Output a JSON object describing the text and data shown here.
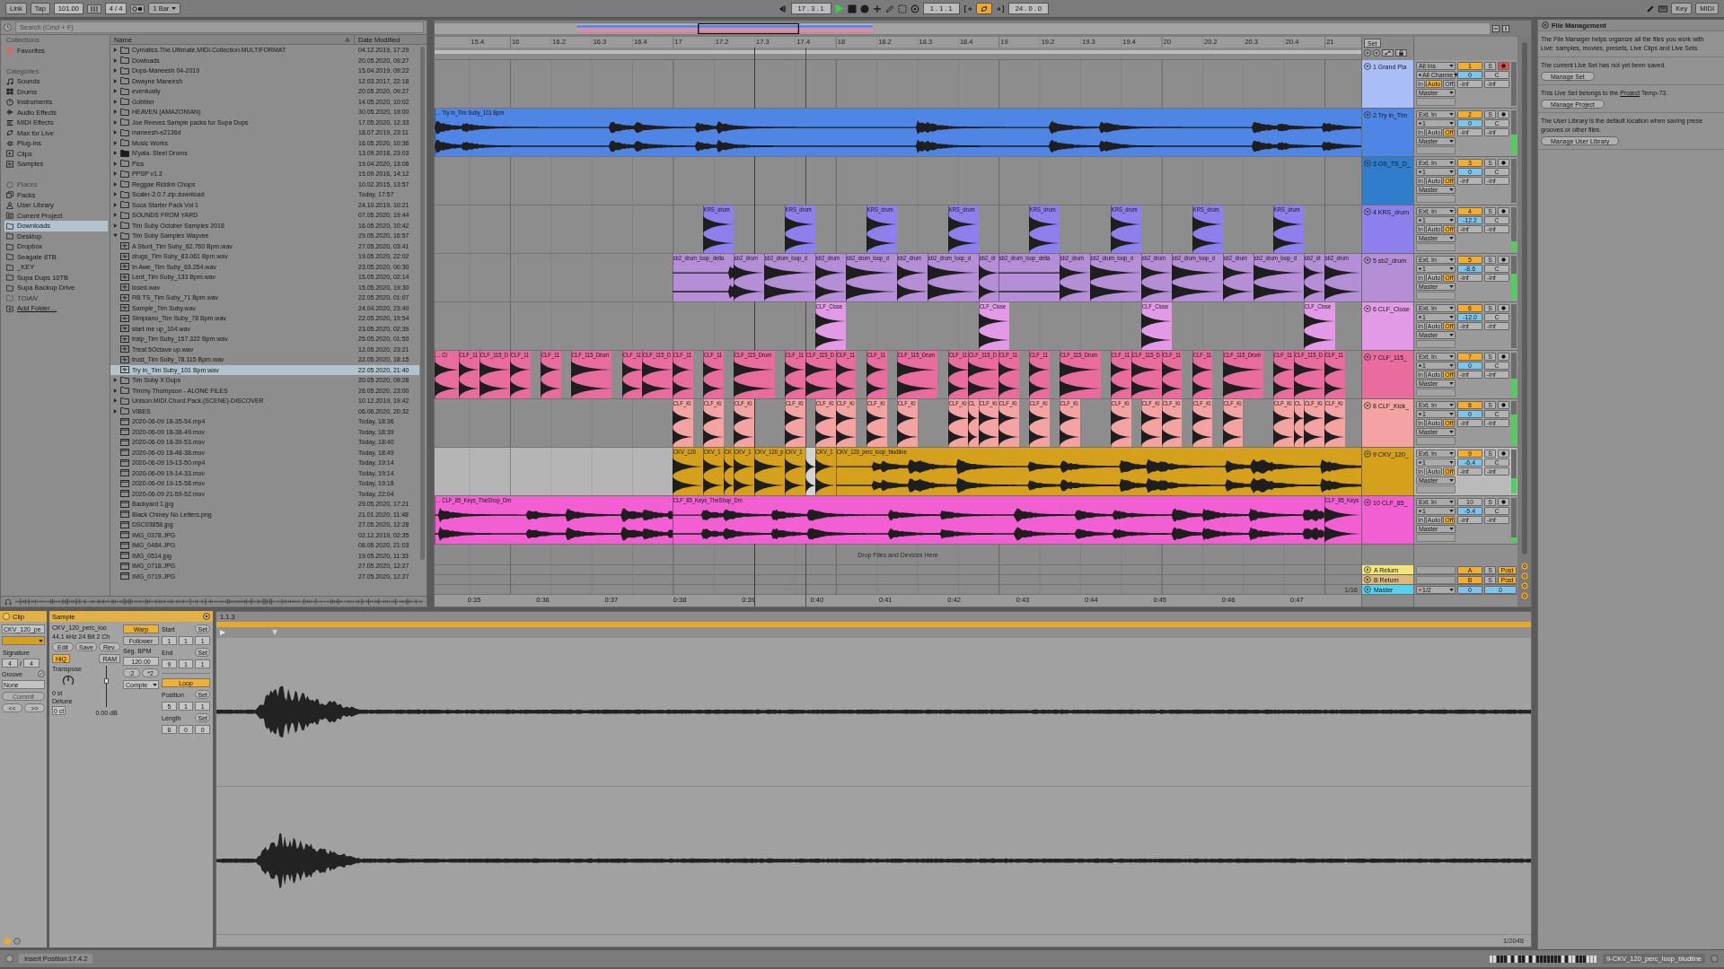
{
  "control_bar": {
    "link": "Link",
    "tap": "Tap",
    "tempo": "101.00",
    "time_signature": "4 / 4",
    "quantization": "1 Bar",
    "position": "17 . 3 . 1",
    "playing": true,
    "loop_start": "1 . 1 . 1",
    "loop_on": true,
    "loop_length": "24 . 0 . 0",
    "key": "Key",
    "midi": "MIDI"
  },
  "browser": {
    "search": {
      "placeholder": "Search (Cmd + F)"
    },
    "collections": {
      "heading": "Collections",
      "items": [
        {
          "label": "Favorites",
          "color": "#c9706e",
          "selected": false
        }
      ]
    },
    "categories": {
      "heading": "Categories",
      "items": [
        {
          "label": "Sounds",
          "selected": false
        },
        {
          "label": "Drums",
          "selected": false
        },
        {
          "label": "Instruments",
          "selected": false
        },
        {
          "label": "Audio Effects",
          "selected": false
        },
        {
          "label": "MIDI Effects",
          "selected": false
        },
        {
          "label": "Max for Live",
          "selected": false
        },
        {
          "label": "Plug-ins",
          "selected": false
        },
        {
          "label": "Clips",
          "selected": false
        },
        {
          "label": "Samples",
          "selected": false
        }
      ]
    },
    "places": {
      "heading": "Places",
      "items": [
        {
          "label": "Packs",
          "kind": "packs",
          "selected": false,
          "disabled": false
        },
        {
          "label": "User Library",
          "kind": "user",
          "selected": false,
          "disabled": false
        },
        {
          "label": "Current Project",
          "kind": "project",
          "selected": false,
          "disabled": false
        },
        {
          "label": "Downloads",
          "kind": "folder",
          "selected": true,
          "disabled": false
        },
        {
          "label": "Desktop",
          "kind": "folder",
          "selected": false,
          "disabled": false
        },
        {
          "label": "Dropbox",
          "kind": "folder",
          "selected": false,
          "disabled": false
        },
        {
          "label": "Seagate 8TB",
          "kind": "folder",
          "selected": false,
          "disabled": false
        },
        {
          "label": "_KEY",
          "kind": "folder",
          "selected": false,
          "disabled": false
        },
        {
          "label": "Supa Dups 10TB",
          "kind": "folder",
          "selected": false,
          "disabled": false
        },
        {
          "label": "Supa Backup Drive",
          "kind": "folder",
          "selected": false,
          "disabled": false
        },
        {
          "label": "TOIAN",
          "kind": "folder",
          "selected": false,
          "disabled": true
        }
      ],
      "add_folder": "Add Folder…"
    },
    "columns": {
      "name": "Name",
      "date": "Date Modified"
    },
    "files": [
      {
        "name": "Cymatics.The.Ultimate.MIDI.Collection.MULTIFORMAT",
        "date": "04.12.2019, 17:29",
        "kind": "folder",
        "expanded": false,
        "selected": false
      },
      {
        "name": "Dowloads",
        "date": "20.05.2020, 09:27",
        "kind": "folder",
        "expanded": false,
        "selected": false
      },
      {
        "name": "Dups-Maneesh 04-2019",
        "date": "15.04.2019, 09:22",
        "kind": "folder",
        "expanded": false,
        "selected": false
      },
      {
        "name": "Dwayne Maneesh",
        "date": "12.03.2017, 22:18",
        "kind": "folder",
        "expanded": false,
        "selected": false
      },
      {
        "name": "eventually",
        "date": "20.05.2020, 09:27",
        "kind": "folder",
        "expanded": false,
        "selected": false
      },
      {
        "name": "Gobbler",
        "date": "14.05.2020, 10:02",
        "kind": "folder",
        "expanded": false,
        "selected": false
      },
      {
        "name": "HEAVEN (AMAZONIAN)",
        "date": "30.05.2020, 19:00",
        "kind": "folder",
        "expanded": false,
        "selected": false
      },
      {
        "name": "Joe Reeves Sample packs for Supa Dups",
        "date": "17.05.2020, 12:33",
        "kind": "folder",
        "expanded": false,
        "selected": false
      },
      {
        "name": "maneesh-e2136d",
        "date": "18.07.2019, 23:11",
        "kind": "folder",
        "expanded": false,
        "selected": false
      },
      {
        "name": "Music Works",
        "date": "16.05.2020, 10:36",
        "kind": "folder",
        "expanded": false,
        "selected": false
      },
      {
        "name": "N'yala. Steel Drums",
        "date": "13.09.2018, 23:03",
        "kind": "pack",
        "expanded": false,
        "selected": false
      },
      {
        "name": "Pics",
        "date": "19.04.2020, 13:06",
        "kind": "folder",
        "expanded": false,
        "selected": false
      },
      {
        "name": "PPSP v1.3",
        "date": "15.09.2016, 14:12",
        "kind": "folder",
        "expanded": false,
        "selected": false
      },
      {
        "name": "Reggae Riddim Chops",
        "date": "10.02.2015, 13:57",
        "kind": "folder",
        "expanded": false,
        "selected": false
      },
      {
        "name": "Scaler-2.0.7.zip.download",
        "date": "Today, 17:57",
        "kind": "folder",
        "expanded": false,
        "selected": false
      },
      {
        "name": "Soca Starter Pack Vol 1",
        "date": "24.10.2019, 10:21",
        "kind": "folder",
        "expanded": false,
        "selected": false
      },
      {
        "name": "SOUNDS FROM YARD",
        "date": "07.05.2020, 19:44",
        "kind": "folder",
        "expanded": false,
        "selected": false
      },
      {
        "name": "Tim Suby October Samples 2018",
        "date": "16.05.2020, 10:42",
        "kind": "folder",
        "expanded": false,
        "selected": false
      },
      {
        "name": "Tim Suby Samples Wayvee",
        "date": "29.05.2020, 16:57",
        "kind": "folder",
        "expanded": true,
        "selected": false,
        "children": [
          {
            "name": "A Stunt_Tim Suby_82.760 Bpm.wav",
            "date": "27.05.2020, 03:41",
            "kind": "audio",
            "selected": false
          },
          {
            "name": "drugs_Tim Suby_83.061 Bpm.wav",
            "date": "19.05.2020, 22:02",
            "kind": "audio",
            "selected": false
          },
          {
            "name": "In Awe_Tim Suby_63.254.wav",
            "date": "23.05.2020, 00:30",
            "kind": "audio",
            "selected": false
          },
          {
            "name": "Lent_Tim Suby_133 Bpm.wav",
            "date": "15.05.2020, 02:14",
            "kind": "audio",
            "selected": false
          },
          {
            "name": "losed.wav",
            "date": "15.05.2020, 19:30",
            "kind": "audio",
            "selected": false
          },
          {
            "name": "RB TS_Tim Suby_71 Bpm.wav",
            "date": "22.05.2020, 01:07",
            "kind": "audio",
            "selected": false
          },
          {
            "name": "Sample_Tim Suby.wav",
            "date": "24.04.2020, 23:40",
            "kind": "audio",
            "selected": false
          },
          {
            "name": "Simpiano_Tim Suby_78 Bpm.wav",
            "date": "22.05.2020, 19:54",
            "kind": "audio",
            "selected": false
          },
          {
            "name": "start me up_104.wav",
            "date": "23.05.2020, 02:39",
            "kind": "audio",
            "selected": false
          },
          {
            "name": "traip_Tim Suby_157.322 Bpm.wav",
            "date": "25.05.2020, 01:50",
            "kind": "audio",
            "selected": false
          },
          {
            "name": "Treat 5Octave up.wav",
            "date": "12.05.2020, 23:21",
            "kind": "audio",
            "selected": false
          },
          {
            "name": "trust_Tim Suby_78.115 Bpm.wav",
            "date": "22.05.2020, 18:15",
            "kind": "audio",
            "selected": false
          },
          {
            "name": "Try in_Tim Suby_101 Bpm.wav",
            "date": "22.05.2020, 21:40",
            "kind": "audio",
            "selected": true
          }
        ]
      },
      {
        "name": "Tim Suby X Dups",
        "date": "20.05.2020, 09:28",
        "kind": "folder",
        "expanded": false,
        "selected": false
      },
      {
        "name": "Timmy Thompson - ALONE FILES",
        "date": "26.05.2020, 23:00",
        "kind": "folder",
        "expanded": false,
        "selected": false
      },
      {
        "name": "Unison.MIDI.Chord.Pack.(SCENE)-DISCOVER",
        "date": "10.12.2019, 19:42",
        "kind": "folder",
        "expanded": false,
        "selected": false
      },
      {
        "name": "VIBES",
        "date": "06.06.2020, 20:32",
        "kind": "folder",
        "expanded": false,
        "selected": false
      },
      {
        "name": "2020-06-09 18-35-54.mp4",
        "date": "Today, 18:36",
        "kind": "file",
        "selected": false
      },
      {
        "name": "2020-06-09 18-38-49.mov",
        "date": "Today, 18:39",
        "kind": "file",
        "selected": false
      },
      {
        "name": "2020-06-09 18-39-53.mov",
        "date": "Today, 18:40",
        "kind": "file",
        "selected": false
      },
      {
        "name": "2020-06-09 18-48-38.mov",
        "date": "Today, 18:49",
        "kind": "file",
        "selected": false
      },
      {
        "name": "2020-06-09 19-13-50.mp4",
        "date": "Today, 19:14",
        "kind": "file",
        "selected": false
      },
      {
        "name": "2020-06-09 19-14-33.mov",
        "date": "Today, 19:14",
        "kind": "file",
        "selected": false
      },
      {
        "name": "2020-06-09 19-15-58.mov",
        "date": "Today, 19:18",
        "kind": "file",
        "selected": false
      },
      {
        "name": "2020-06-09 21-59-52.mov",
        "date": "Today, 22:04",
        "kind": "file",
        "selected": false
      },
      {
        "name": "Backyard 1.jpg",
        "date": "29.05.2020, 17:21",
        "kind": "file",
        "selected": false
      },
      {
        "name": "Black Chiney No Letters.png",
        "date": "21.01.2020, 11:48",
        "kind": "file",
        "selected": false
      },
      {
        "name": "DSC03858.jpg",
        "date": "27.05.2020, 12:28",
        "kind": "file",
        "selected": false
      },
      {
        "name": "IMG_0378.JPG",
        "date": "02.12.2019, 02:35",
        "kind": "file",
        "selected": false
      },
      {
        "name": "IMG_0484.JPG",
        "date": "08.05.2020, 21:03",
        "kind": "file",
        "selected": false
      },
      {
        "name": "IMG_0514.jpg",
        "date": "19.05.2020, 11:33",
        "kind": "file",
        "selected": false
      },
      {
        "name": "IMG_0718.JPG",
        "date": "27.05.2020, 12:27",
        "kind": "file",
        "selected": false
      },
      {
        "name": "IMG_0719.JPG",
        "date": "27.05.2020, 12:27",
        "kind": "file",
        "selected": false
      }
    ]
  },
  "arrangement": {
    "ruler": [
      "15.4",
      "16",
      "16.2",
      "16.3",
      "16.4",
      "17",
      "17.2",
      "17.3",
      "17.4",
      "18",
      "18.2",
      "18.3",
      "18.4",
      "19",
      "19.2",
      "19.3",
      "19.4",
      "20",
      "20.2",
      "20.3",
      "20.4",
      "21"
    ],
    "set_button": "Set",
    "drop_hint": "Drop Files and Devices Here",
    "grid": "1/16",
    "time_ruler": [
      "0:35",
      "0:36",
      "0:37",
      "0:38",
      "0:39",
      "0:40",
      "0:41",
      "0:42",
      "0:43",
      "0:44",
      "0:45",
      "0:46",
      "0:47"
    ],
    "tracks": [
      {
        "number": "1",
        "name": "1 Grand Pia",
        "color": "#a9bef6",
        "selected": false,
        "active": true,
        "armed": true,
        "input": "All Ins",
        "channel": "All Channe",
        "monitor": [
          {
            "label": "In",
            "selected": false
          },
          {
            "label": "Auto",
            "selected": true
          },
          {
            "label": "Off",
            "selected": false
          }
        ],
        "output": "Master",
        "volume": "0",
        "pan": "C",
        "solo": "S",
        "peaks": [
          "-inf",
          "-inf"
        ],
        "meter": {
          "level": 0
        }
      },
      {
        "number": "2",
        "name": "2 Try in_Tim",
        "color": "#4f86e6",
        "selected": false,
        "active": true,
        "armed": false,
        "input": "Ext. In",
        "channel": "1",
        "monitor": [
          {
            "label": "In",
            "selected": false
          },
          {
            "label": "Auto",
            "selected": false
          },
          {
            "label": "Off",
            "selected": true
          }
        ],
        "output": "Master",
        "volume": "0",
        "pan": "C",
        "solo": "S",
        "peaks": [
          "-inf",
          "-inf"
        ],
        "meter": {
          "level": 0.45
        },
        "clips": [
          {
            "name": "… Try in_Tim Suby_101 Bpm",
            "selected": false
          }
        ]
      },
      {
        "number": "3",
        "name": "3 OS_TS_D_",
        "color": "#2f7dcb",
        "selected": false,
        "active": true,
        "armed": false,
        "input": "Ext. In",
        "channel": "1",
        "monitor": [
          {
            "label": "In",
            "selected": false
          },
          {
            "label": "Auto",
            "selected": false
          },
          {
            "label": "Off",
            "selected": true
          }
        ],
        "output": "Master",
        "volume": "0",
        "pan": "C",
        "solo": "S",
        "peaks": [
          "-inf",
          "-inf"
        ],
        "meter": {
          "level": 0
        }
      },
      {
        "number": "4",
        "name": "4 KRS_drum",
        "color": "#8e80ec",
        "selected": false,
        "active": true,
        "armed": false,
        "input": "Ext. In",
        "channel": "1",
        "monitor": [
          {
            "label": "In",
            "selected": false
          },
          {
            "label": "Auto",
            "selected": false
          },
          {
            "label": "Off",
            "selected": true
          }
        ],
        "output": "Master",
        "volume": "-12.2",
        "pan": "C",
        "solo": "S",
        "peaks": [
          "-inf",
          "-inf"
        ],
        "meter": {
          "level": 0.22
        },
        "clips": [
          {
            "name": "KRS_drum",
            "selected": false
          },
          {
            "name": "KRS_drum",
            "selected": false
          },
          {
            "name": "KRS_drum",
            "selected": false
          },
          {
            "name": "KRS_drum",
            "selected": false
          },
          {
            "name": "KRS_drum",
            "selected": false
          },
          {
            "name": "KRS_drum",
            "selected": false
          },
          {
            "name": "KRS_drum",
            "selected": false
          },
          {
            "name": "KRS_drum",
            "selected": false
          }
        ]
      },
      {
        "number": "5",
        "name": "5 sb2_drum",
        "color": "#b48fd6",
        "selected": false,
        "active": true,
        "armed": false,
        "input": "Ext. In",
        "channel": "1",
        "monitor": [
          {
            "label": "In",
            "selected": false
          },
          {
            "label": "Auto",
            "selected": false
          },
          {
            "label": "Off",
            "selected": true
          }
        ],
        "output": "Master",
        "volume": "-8.6",
        "pan": "C",
        "solo": "S",
        "peaks": [
          "-inf",
          "-inf"
        ],
        "meter": {
          "level": 0.6
        },
        "clips": [
          {
            "name": "sb2_drum_loop_delta",
            "selected": false
          },
          {
            "name": "sb2_drum",
            "selected": false
          },
          {
            "name": "sb2_drum_loop_d",
            "selected": false
          },
          {
            "name": "sb2_drum",
            "selected": false
          },
          {
            "name": "sb2_drum_loop_d",
            "selected": false
          },
          {
            "name": "sb2_drum",
            "selected": false
          },
          {
            "name": "sb2_drum_loop_d",
            "selected": false
          },
          {
            "name": "sb2_dr",
            "selected": false
          },
          {
            "name": "sb2_drum_loop_delta",
            "selected": false
          },
          {
            "name": "sb2_drum",
            "selected": false
          },
          {
            "name": "sb2_drum_loop_d",
            "selected": false
          },
          {
            "name": "sb2_drum",
            "selected": false
          },
          {
            "name": "sb2_drum_loop_d",
            "selected": false
          },
          {
            "name": "sb2_drum",
            "selected": false
          },
          {
            "name": "sb2_drum_loop_d",
            "selected": false
          },
          {
            "name": "sb2_dr",
            "selected": false
          },
          {
            "name": "sb2_drum",
            "selected": false
          }
        ]
      },
      {
        "number": "6",
        "name": "6 CLF_Close",
        "color": "#e39ae6",
        "selected": false,
        "active": true,
        "armed": false,
        "input": "Ext. In",
        "channel": "1",
        "monitor": [
          {
            "label": "In",
            "selected": false
          },
          {
            "label": "Auto",
            "selected": false
          },
          {
            "label": "Off",
            "selected": true
          }
        ],
        "output": "Master",
        "volume": "-12.0",
        "pan": "C",
        "solo": "S",
        "peaks": [
          "-inf",
          "-inf"
        ],
        "meter": {
          "level": 0
        },
        "clips": [
          {
            "name": "CLF_Close",
            "selected": false
          },
          {
            "name": "CLF_Close",
            "selected": false
          },
          {
            "name": "CLF_Close",
            "selected": false
          },
          {
            "name": "CLF_Close",
            "selected": false
          }
        ]
      },
      {
        "number": "7",
        "name": "7 CLF_115_",
        "color": "#e86c9e",
        "selected": false,
        "active": true,
        "armed": false,
        "input": "Ext. In",
        "channel": "1",
        "monitor": [
          {
            "label": "In",
            "selected": false
          },
          {
            "label": "Auto",
            "selected": false
          },
          {
            "label": "Off",
            "selected": true
          }
        ],
        "output": "Master",
        "volume": "0",
        "pan": "C",
        "solo": "S",
        "peaks": [
          "-inf",
          "-inf"
        ],
        "meter": {
          "level": 0.4
        },
        "clips": [
          {
            "name": "… Cl",
            "selected": false
          },
          {
            "name": "CLF_11",
            "selected": false
          },
          {
            "name": "CLF_115_D",
            "selected": false
          },
          {
            "name": "CLF_11",
            "selected": false
          },
          {
            "name": "CLF_11",
            "selected": false
          },
          {
            "name": "CLF_115_Drum",
            "selected": false
          },
          {
            "name": "CLF_11",
            "selected": false
          },
          {
            "name": "CLF_115_D",
            "selected": false
          },
          {
            "name": "CLF_11",
            "selected": false
          },
          {
            "name": "CLF_11",
            "selected": false
          },
          {
            "name": "CLF_115_Drum",
            "selected": false
          },
          {
            "name": "CLF_11",
            "selected": false
          },
          {
            "name": "CLF_115_D",
            "selected": false
          },
          {
            "name": "CLF_11",
            "selected": false
          },
          {
            "name": "CLF_11",
            "selected": false
          },
          {
            "name": "CLF_115_Drum",
            "selected": false
          },
          {
            "name": "CLF_11",
            "selected": false
          },
          {
            "name": "CLF_115_D",
            "selected": false
          },
          {
            "name": "CLF_11",
            "selected": false
          },
          {
            "name": "CLF_11",
            "selected": false
          },
          {
            "name": "CLF_115_Drum",
            "selected": false
          },
          {
            "name": "CLF_11",
            "selected": false
          },
          {
            "name": "CLF_115_D",
            "selected": false
          },
          {
            "name": "CLF_11",
            "selected": false
          },
          {
            "name": "CLF_11",
            "selected": false
          },
          {
            "name": "CLF_115_Drum",
            "selected": false
          },
          {
            "name": "CLF_11",
            "selected": false
          },
          {
            "name": "CLF_115_D",
            "selected": false
          },
          {
            "name": "CLF_11",
            "selected": false
          }
        ]
      },
      {
        "number": "8",
        "name": "8 CLF_Kick_",
        "color": "#f4a3a3",
        "selected": false,
        "active": true,
        "armed": false,
        "input": "Ext. In",
        "channel": "1",
        "monitor": [
          {
            "label": "In",
            "selected": false
          },
          {
            "label": "Auto",
            "selected": false
          },
          {
            "label": "Off",
            "selected": true
          }
        ],
        "output": "Master",
        "volume": "0",
        "pan": "C",
        "solo": "S",
        "peaks": [
          "-inf",
          "-inf"
        ],
        "meter": {
          "level": 0.7
        },
        "clips": [
          {
            "name": "CLF_Ki",
            "selected": false
          },
          {
            "name": "CLF_Ki",
            "selected": false
          },
          {
            "name": "CLF_Ki",
            "selected": false
          },
          {
            "name": "CLF_Ki",
            "selected": false
          },
          {
            "name": "CLF_Ki",
            "selected": false
          },
          {
            "name": "CLF_Ki",
            "selected": false
          },
          {
            "name": "CLF_Ki",
            "selected": false
          },
          {
            "name": "CLF_Ki",
            "selected": false
          },
          {
            "name": "CLF_Ki",
            "selected": false
          },
          {
            "name": "CL",
            "selected": false
          },
          {
            "name": "CLF_Ki",
            "selected": false
          },
          {
            "name": "CLF_Ki",
            "selected": false
          },
          {
            "name": "CLF_Ki",
            "selected": false
          },
          {
            "name": "CLF_Ki",
            "selected": false
          },
          {
            "name": "CLF_Ki",
            "selected": false
          },
          {
            "name": "CLF_Ki",
            "selected": false
          },
          {
            "name": "CLF_Ki",
            "selected": false
          },
          {
            "name": "CLF_Ki",
            "selected": false
          },
          {
            "name": "CLF_Ki",
            "selected": false
          },
          {
            "name": "CLF_Ki",
            "selected": false
          },
          {
            "name": "CL",
            "selected": false
          },
          {
            "name": "CLF_Ki",
            "selected": false
          },
          {
            "name": "CLF_Ki",
            "selected": false
          }
        ]
      },
      {
        "number": "9",
        "name": "9 CKV_120_",
        "color": "#d5a01b",
        "selected": true,
        "active": true,
        "armed": false,
        "input": "Ext. In",
        "channel": "1",
        "monitor": [
          {
            "label": "In",
            "selected": false
          },
          {
            "label": "Auto",
            "selected": false
          },
          {
            "label": "Off",
            "selected": true
          }
        ],
        "output": "Master",
        "volume": "-6.4",
        "pan": "C",
        "solo": "S",
        "peaks": [
          "-inf",
          "-inf"
        ],
        "meter": {
          "level": 0.35
        },
        "clips": [
          {
            "name": "CKV_120",
            "selected": false
          },
          {
            "name": "CKV_1",
            "selected": false
          },
          {
            "name": "CK",
            "selected": false
          },
          {
            "name": "CKV_1",
            "selected": false
          },
          {
            "name": "CKV_120_p",
            "selected": false
          },
          {
            "name": "CKV_1",
            "selected": false
          },
          {
            "selected": true
          },
          {
            "name": "CKV_1",
            "selected": false
          },
          {
            "name": "CKV_120_perc_loop_bludline",
            "selected": false
          }
        ]
      },
      {
        "number": "10",
        "name": "10 CLF_85_",
        "color": "#f25fd3",
        "selected": false,
        "active": false,
        "armed": false,
        "input": "Ext. In",
        "channel": "1",
        "monitor": [
          {
            "label": "In",
            "selected": false
          },
          {
            "label": "Auto",
            "selected": false
          },
          {
            "label": "Off",
            "selected": true
          }
        ],
        "output": "Master",
        "volume": "-5.4",
        "pan": "C",
        "solo": "S",
        "peaks": [
          "-inf",
          "-inf"
        ],
        "meter": {
          "level": 0.1
        },
        "clips": [
          {
            "name": "… CLF_85_Keys_TheShop_Dm",
            "selected": false
          },
          {
            "name": "CLF_85_Keys_TheShop_Dm",
            "selected": false
          },
          {
            "name": "CLF_85_Keys",
            "selected": false
          }
        ]
      }
    ],
    "returns": [
      {
        "number": "A",
        "name": "A Return",
        "color": "#f2e67a",
        "active": true,
        "solo": "S",
        "post": {
          "label": "Post",
          "on": true
        }
      },
      {
        "number": "B",
        "name": "B Return",
        "color": "#dcb87a",
        "active": true,
        "solo": "S",
        "post": {
          "label": "Post",
          "on": true
        }
      }
    ],
    "master": {
      "name": "Master",
      "color": "#58d2ec",
      "output": "1/2",
      "volume": "0",
      "pan": "0"
    }
  },
  "clip_view": {
    "clip": {
      "title": "Clip",
      "name": "CKV_120_pe",
      "signature_label": "Signature",
      "numerator": "4",
      "slash": "/",
      "denominator": "4",
      "groove_label": "Groove",
      "groove": "None",
      "commit": "Commit",
      "commit_disabled": true,
      "nudge_back": "<<",
      "nudge_forward": ">>"
    },
    "sample": {
      "title": "Sample",
      "file": "CKV_120_perc_loo",
      "format": "44.1 kHz 24 Bit 2 Ch",
      "actions": [
        "Edit",
        "Save",
        "Rev."
      ],
      "hiq": {
        "label": "HiQ",
        "on": true
      },
      "ram": {
        "label": "RAM",
        "on": false
      },
      "transpose_label": "Transpose",
      "transpose": "0 st",
      "detune_label": "Detune",
      "detune": "0 ct",
      "gain_slider": {
        "level": 0.62
      },
      "gain": "0.00 dB",
      "warp": {
        "label": "Warp",
        "on": true
      },
      "follower": "Follower",
      "seg_bpm_label": "Seg. BPM",
      "seg_bpm": "120.00",
      "halve": ":2",
      "double": "*2",
      "warp_mode": "Comple",
      "markers": [
        {
          "label": "Start",
          "set": "Set",
          "values": [
            "1",
            "1",
            "1"
          ]
        },
        {
          "label": "End",
          "set": "Set",
          "values": [
            "9",
            "1",
            "1"
          ]
        }
      ],
      "loop": {
        "label": "Loop",
        "on": true
      },
      "loop_markers": [
        {
          "label": "Position",
          "set": "Set",
          "values": [
            "5",
            "1",
            "1"
          ]
        },
        {
          "label": "Length",
          "set": "Set",
          "values": [
            "8",
            "0",
            "0"
          ]
        }
      ]
    },
    "editor": {
      "ruler_label": "1.1.3",
      "zoom": "1/2048"
    }
  },
  "info_panel": {
    "title": "File Management",
    "sections": [
      {
        "text": "The File Manager helps organize all the files you work with\nLive: samples, movies, presets, Live Clips and Live Sets."
      },
      {
        "text": "The current Live Set has not yet been saved.",
        "button": "Manage Set"
      },
      {
        "text": "This Live Set belongs to the ",
        "link": "Project",
        "text_after": " Temp-73.",
        "button": "Manage Project"
      },
      {
        "text": "The User Library is the default location when saving prese\ngrooves or other files.",
        "button": "Manage User Library"
      }
    ]
  },
  "status_bar": {
    "message": "Insert Position:17.4.2",
    "clip": "9-CKV_120_perc_loop_bludline"
  }
}
